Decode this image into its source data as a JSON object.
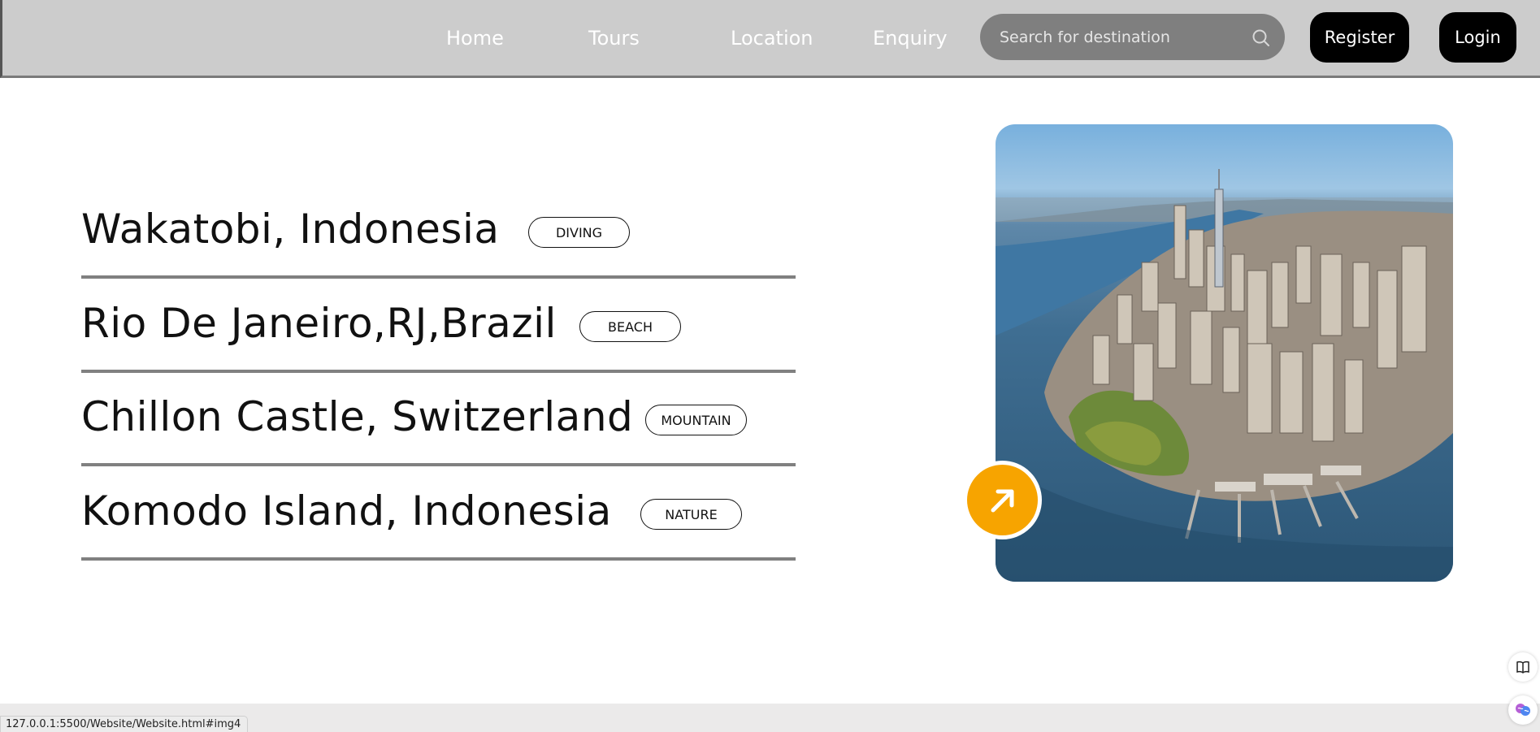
{
  "nav": {
    "links": [
      "Home",
      "Tours",
      "Location",
      "Enquiry"
    ],
    "search_placeholder": "Search for destination",
    "register_label": "Register",
    "login_label": "Login"
  },
  "destinations": [
    {
      "name": "Wakatobi, Indonesia",
      "tag": "DIVING"
    },
    {
      "name": "Rio De Janeiro,RJ,Brazil",
      "tag": "BEACH"
    },
    {
      "name": "Chillon Castle, Switzerland",
      "tag": "MOUNTAIN"
    },
    {
      "name": "Komodo Island, Indonesia",
      "tag": "NATURE"
    }
  ],
  "hero": {
    "image": "aerial city skyline photo",
    "arrow_icon": "arrow-up-right-icon"
  },
  "status_bar": {
    "url": "127.0.0.1:5500/Website/Website.html#img4"
  },
  "colors": {
    "navbar": "#cccccc",
    "accent": "#f7a400",
    "button": "#000000",
    "search": "#7f7f7f"
  }
}
